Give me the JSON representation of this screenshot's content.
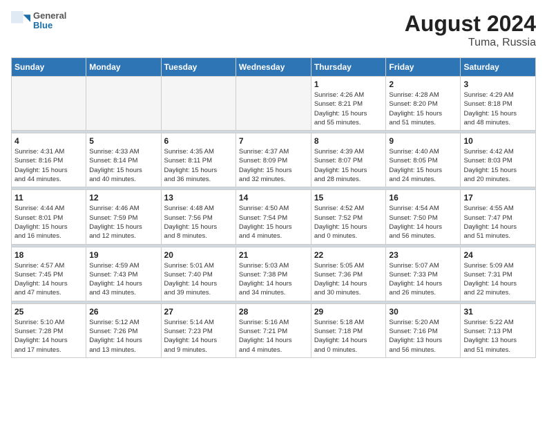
{
  "header": {
    "logo_line1": "General",
    "logo_line2": "Blue",
    "title": "August 2024",
    "subtitle": "Tuma, Russia"
  },
  "days_of_week": [
    "Sunday",
    "Monday",
    "Tuesday",
    "Wednesday",
    "Thursday",
    "Friday",
    "Saturday"
  ],
  "weeks": [
    [
      {
        "day": "",
        "info": ""
      },
      {
        "day": "",
        "info": ""
      },
      {
        "day": "",
        "info": ""
      },
      {
        "day": "",
        "info": ""
      },
      {
        "day": "1",
        "info": "Sunrise: 4:26 AM\nSunset: 8:21 PM\nDaylight: 15 hours\nand 55 minutes."
      },
      {
        "day": "2",
        "info": "Sunrise: 4:28 AM\nSunset: 8:20 PM\nDaylight: 15 hours\nand 51 minutes."
      },
      {
        "day": "3",
        "info": "Sunrise: 4:29 AM\nSunset: 8:18 PM\nDaylight: 15 hours\nand 48 minutes."
      }
    ],
    [
      {
        "day": "4",
        "info": "Sunrise: 4:31 AM\nSunset: 8:16 PM\nDaylight: 15 hours\nand 44 minutes."
      },
      {
        "day": "5",
        "info": "Sunrise: 4:33 AM\nSunset: 8:14 PM\nDaylight: 15 hours\nand 40 minutes."
      },
      {
        "day": "6",
        "info": "Sunrise: 4:35 AM\nSunset: 8:11 PM\nDaylight: 15 hours\nand 36 minutes."
      },
      {
        "day": "7",
        "info": "Sunrise: 4:37 AM\nSunset: 8:09 PM\nDaylight: 15 hours\nand 32 minutes."
      },
      {
        "day": "8",
        "info": "Sunrise: 4:39 AM\nSunset: 8:07 PM\nDaylight: 15 hours\nand 28 minutes."
      },
      {
        "day": "9",
        "info": "Sunrise: 4:40 AM\nSunset: 8:05 PM\nDaylight: 15 hours\nand 24 minutes."
      },
      {
        "day": "10",
        "info": "Sunrise: 4:42 AM\nSunset: 8:03 PM\nDaylight: 15 hours\nand 20 minutes."
      }
    ],
    [
      {
        "day": "11",
        "info": "Sunrise: 4:44 AM\nSunset: 8:01 PM\nDaylight: 15 hours\nand 16 minutes."
      },
      {
        "day": "12",
        "info": "Sunrise: 4:46 AM\nSunset: 7:59 PM\nDaylight: 15 hours\nand 12 minutes."
      },
      {
        "day": "13",
        "info": "Sunrise: 4:48 AM\nSunset: 7:56 PM\nDaylight: 15 hours\nand 8 minutes."
      },
      {
        "day": "14",
        "info": "Sunrise: 4:50 AM\nSunset: 7:54 PM\nDaylight: 15 hours\nand 4 minutes."
      },
      {
        "day": "15",
        "info": "Sunrise: 4:52 AM\nSunset: 7:52 PM\nDaylight: 15 hours\nand 0 minutes."
      },
      {
        "day": "16",
        "info": "Sunrise: 4:54 AM\nSunset: 7:50 PM\nDaylight: 14 hours\nand 56 minutes."
      },
      {
        "day": "17",
        "info": "Sunrise: 4:55 AM\nSunset: 7:47 PM\nDaylight: 14 hours\nand 51 minutes."
      }
    ],
    [
      {
        "day": "18",
        "info": "Sunrise: 4:57 AM\nSunset: 7:45 PM\nDaylight: 14 hours\nand 47 minutes."
      },
      {
        "day": "19",
        "info": "Sunrise: 4:59 AM\nSunset: 7:43 PM\nDaylight: 14 hours\nand 43 minutes."
      },
      {
        "day": "20",
        "info": "Sunrise: 5:01 AM\nSunset: 7:40 PM\nDaylight: 14 hours\nand 39 minutes."
      },
      {
        "day": "21",
        "info": "Sunrise: 5:03 AM\nSunset: 7:38 PM\nDaylight: 14 hours\nand 34 minutes."
      },
      {
        "day": "22",
        "info": "Sunrise: 5:05 AM\nSunset: 7:36 PM\nDaylight: 14 hours\nand 30 minutes."
      },
      {
        "day": "23",
        "info": "Sunrise: 5:07 AM\nSunset: 7:33 PM\nDaylight: 14 hours\nand 26 minutes."
      },
      {
        "day": "24",
        "info": "Sunrise: 5:09 AM\nSunset: 7:31 PM\nDaylight: 14 hours\nand 22 minutes."
      }
    ],
    [
      {
        "day": "25",
        "info": "Sunrise: 5:10 AM\nSunset: 7:28 PM\nDaylight: 14 hours\nand 17 minutes."
      },
      {
        "day": "26",
        "info": "Sunrise: 5:12 AM\nSunset: 7:26 PM\nDaylight: 14 hours\nand 13 minutes."
      },
      {
        "day": "27",
        "info": "Sunrise: 5:14 AM\nSunset: 7:23 PM\nDaylight: 14 hours\nand 9 minutes."
      },
      {
        "day": "28",
        "info": "Sunrise: 5:16 AM\nSunset: 7:21 PM\nDaylight: 14 hours\nand 4 minutes."
      },
      {
        "day": "29",
        "info": "Sunrise: 5:18 AM\nSunset: 7:18 PM\nDaylight: 14 hours\nand 0 minutes."
      },
      {
        "day": "30",
        "info": "Sunrise: 5:20 AM\nSunset: 7:16 PM\nDaylight: 13 hours\nand 56 minutes."
      },
      {
        "day": "31",
        "info": "Sunrise: 5:22 AM\nSunset: 7:13 PM\nDaylight: 13 hours\nand 51 minutes."
      }
    ]
  ]
}
